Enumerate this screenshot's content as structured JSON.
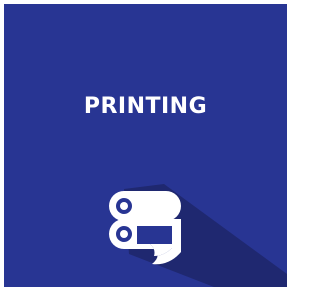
{
  "tile": {
    "title": "PRINTING",
    "icon": "printer-rollers-icon",
    "background_color": "#283593",
    "text_color": "#ffffff",
    "shadow_color": "#1f2870"
  }
}
